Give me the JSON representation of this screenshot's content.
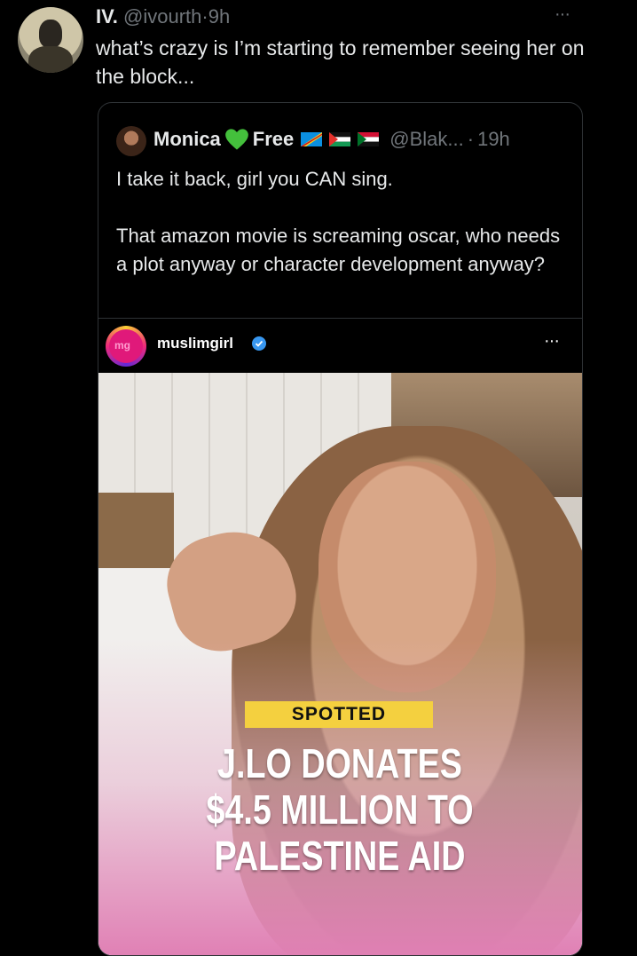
{
  "tweet": {
    "name": "IV.",
    "handle": "@ivourth",
    "separator": "·",
    "time": "9h",
    "more": "···",
    "text": "what’s crazy is I’m starting to remember seeing her on the block..."
  },
  "quoted": {
    "name": "Monica",
    "name_suffix": "Free",
    "handle": "@Blak...",
    "separator": "·",
    "time": "19h",
    "line1": "I take it back, girl you CAN sing.",
    "line2": "That amazon movie is screaming oscar, who needs a plot anyway or character development anyway?"
  },
  "embed": {
    "username": "muslimgirl",
    "avatar_text": "mg",
    "more": "···",
    "tag": "SPOTTED",
    "headline": [
      "J.LO DONATES",
      "$4.5 MILLION TO",
      "PALESTINE AID"
    ]
  },
  "colors": {
    "accent_heart": "#44c03c",
    "verified": "#3897f0",
    "tag_bg": "#f4d03f"
  }
}
